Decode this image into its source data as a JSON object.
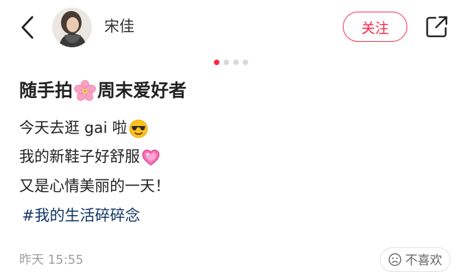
{
  "header": {
    "back_icon": "chevron-left-icon",
    "author_name": "宋佳",
    "follow_label": "关注",
    "share_icon": "share-icon",
    "accent_color": "#ff2442"
  },
  "carousel": {
    "total_pages": 4,
    "current_page": 1
  },
  "post": {
    "title_part1": "随手拍",
    "title_emoji": "cherry-blossom-emoji",
    "title_part2": "周末爱好者",
    "lines": [
      {
        "text": "今天去逛 gai 啦",
        "emoji": "sunglasses-face-emoji"
      },
      {
        "text": "我的新鞋子好舒服",
        "emoji": "sparkling-heart-emoji"
      },
      {
        "text": "又是心情美丽的一天！"
      }
    ],
    "hashtag": "#我的生活碎碎念",
    "hashtag_color": "#133667"
  },
  "footer": {
    "timestamp": "昨天 15:55",
    "dislike_label": "不喜欢",
    "dislike_icon": "sad-face-icon"
  }
}
